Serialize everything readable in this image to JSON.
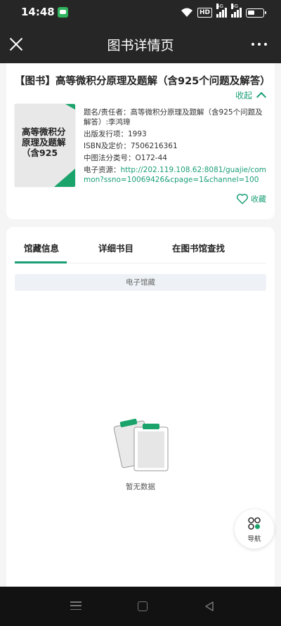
{
  "status": {
    "time": "14:48",
    "hd": "HD",
    "net1": "5G",
    "net2": "5G"
  },
  "header": {
    "title": "图书详情页"
  },
  "book": {
    "title": "【图书】高等微积分原理及题解（含925个问题及解答）",
    "collapse_label": "收起",
    "cover_text": "高等微积分原理及题解（含925",
    "meta": [
      {
        "label": "题名/责任者：",
        "value": "高等微积分原理及题解（含925个问题及解答）:李鸿璋"
      },
      {
        "label": "出版发行项：",
        "value": "1993"
      },
      {
        "label": "ISBN及定价：",
        "value": "7506216361"
      },
      {
        "label": "中图法分类号：",
        "value": "O172-44"
      }
    ],
    "eresource_label": "电子资源：",
    "eresource_url": "http://202.119.108.62:8081/guajie/common?ssno=10069426&cpage=1&channel=100",
    "favorite_label": "收藏"
  },
  "tabs": [
    {
      "label": "馆藏信息"
    },
    {
      "label": "详细书目"
    },
    {
      "label": "在图书馆查找"
    }
  ],
  "subsection": "电子馆藏",
  "empty_text": "暂无数据",
  "nav_button": "导航",
  "colors": {
    "accent": "#1a9e76",
    "topbar": "#262626"
  }
}
